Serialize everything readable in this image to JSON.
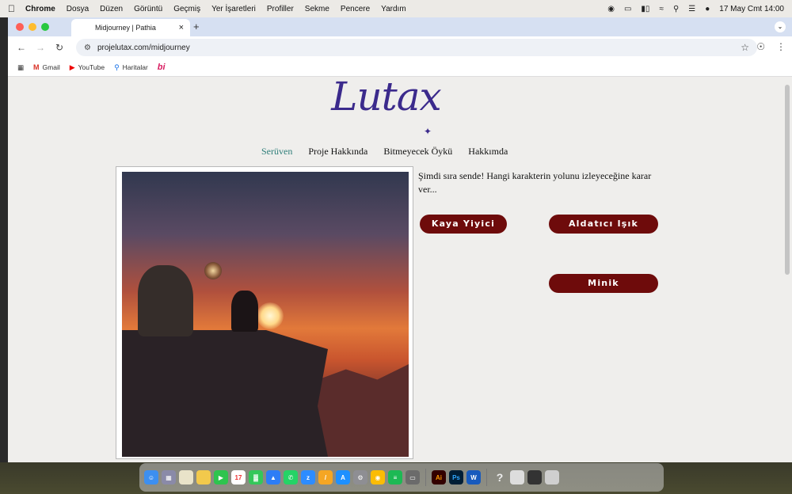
{
  "menubar": {
    "app": "Chrome",
    "items": [
      "Dosya",
      "Düzen",
      "Görüntü",
      "Geçmiş",
      "Yer İşaretleri",
      "Profiller",
      "Sekme",
      "Pencere",
      "Yardım"
    ],
    "datetime": "17 May Cmt 14:00"
  },
  "browser": {
    "tab_title": "Midjourney | Pathia",
    "url": "projelutax.com/midjourney",
    "bookmarks": [
      "Gmail",
      "YouTube",
      "Haritalar"
    ]
  },
  "site": {
    "logo": "Lutax",
    "nav": [
      "Serüven",
      "Proje Hakkında",
      "Bitmeyecek Öykü",
      "Hakkımda"
    ],
    "prompt": "Şimdi sıra sende! Hangi karakterin yolunu izleyeceğine karar ver...",
    "choices": [
      "Kaya Yiyici",
      "Aldatıcı Işık",
      "Minik"
    ]
  },
  "colors": {
    "accent_button": "#6e0b0b",
    "logo": "#3b2a8c",
    "nav_active": "#2f7f7a"
  }
}
